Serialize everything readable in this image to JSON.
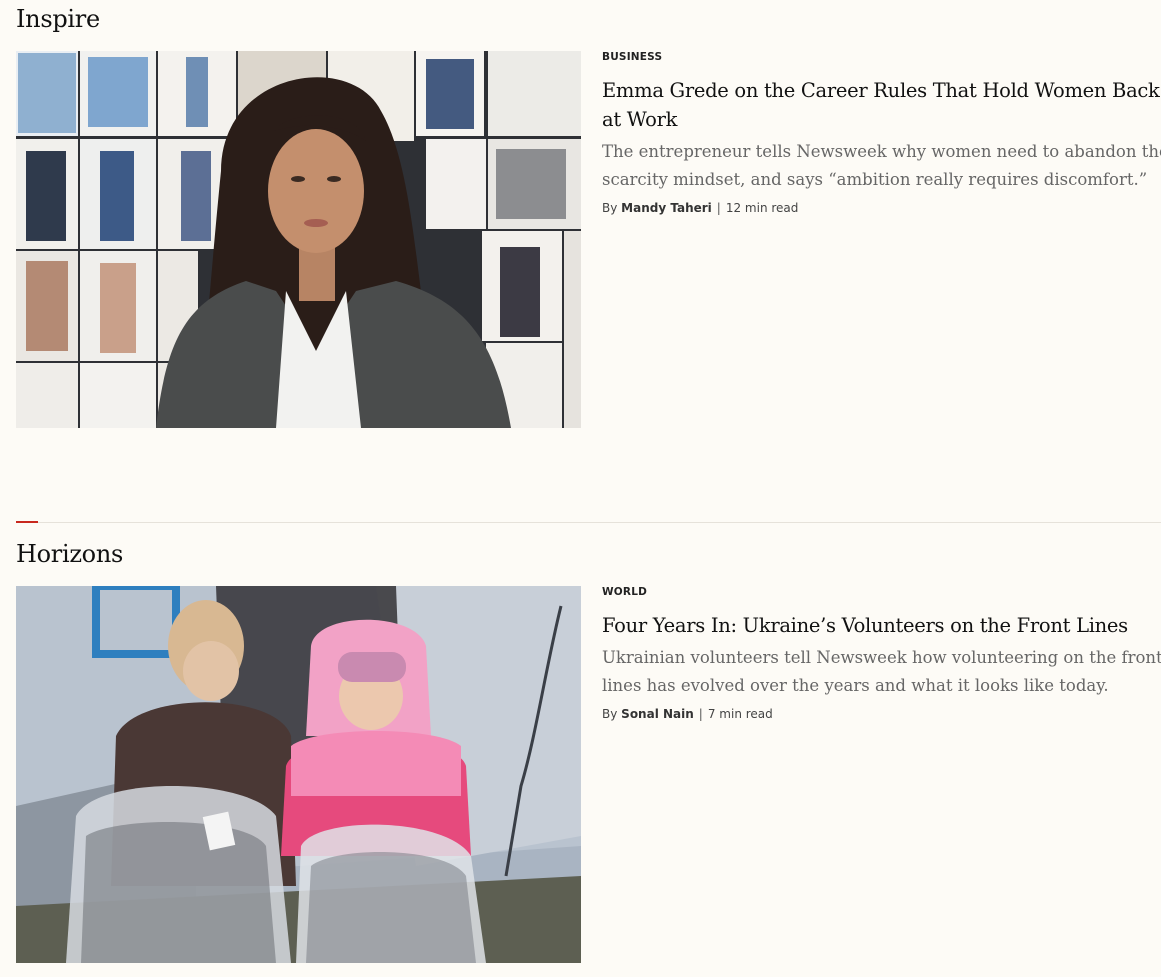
{
  "sections": [
    {
      "title": "Inspire",
      "article": {
        "category": "BUSINESS",
        "headline": "Emma Grede on the Career Rules That Hold Women Back at Work",
        "dek": "The entrepreneur tells Newsweek why women need to abandon the scarcity mindset, and says “ambition really requires discomfort.”",
        "by_prefix": "By",
        "author": "Mandy Taheri",
        "separator": "|",
        "read_time": "12 min read",
        "image": "photo-woman-dark-hair-blazer-moodboard"
      }
    },
    {
      "title": "Horizons",
      "article": {
        "category": "WORLD",
        "headline": "Four Years In: Ukraine’s Volunteers on the Front Lines",
        "dek": "Ukrainian volunteers tell Newsweek how volunteering on the front lines has evolved over the years and what it looks like today.",
        "by_prefix": "By",
        "author": "Sonal Nain",
        "separator": "|",
        "read_time": "7 min read",
        "image": "photo-two-children-holding-plastic-bags"
      }
    }
  ],
  "colors": {
    "background": "#fdfbf6",
    "accent": "#c8281e",
    "rule": "#e6e2da",
    "dek_text": "#666666"
  }
}
